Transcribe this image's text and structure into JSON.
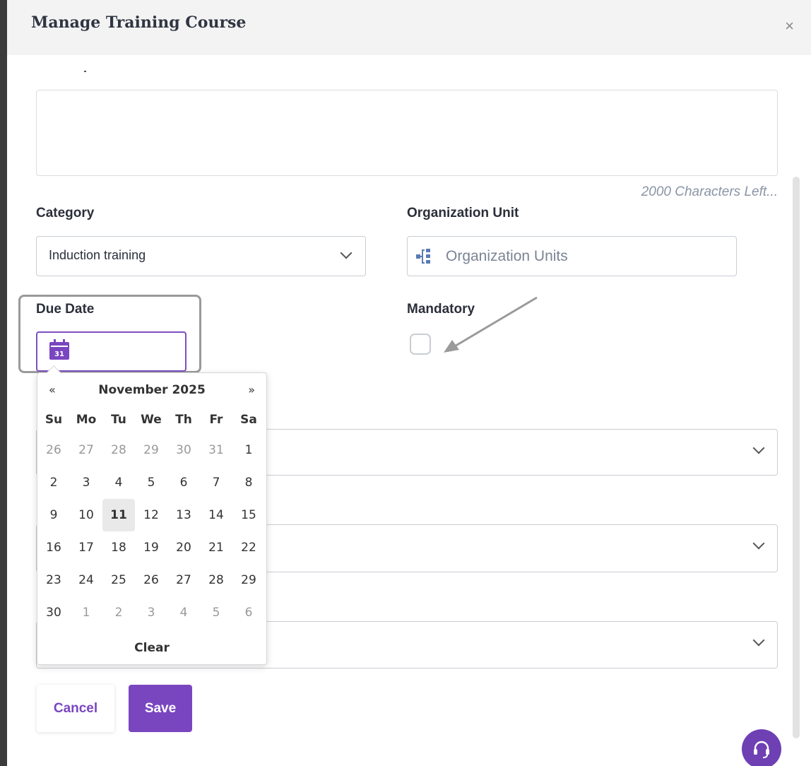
{
  "modal": {
    "title": "Manage Training Course",
    "close_symbol": "×"
  },
  "description": {
    "chars_left": "2000 Characters Left..."
  },
  "category": {
    "label": "Category",
    "value": "Induction training"
  },
  "organization_unit": {
    "label": "Organization Unit",
    "placeholder": "Organization Units"
  },
  "due_date": {
    "label": "Due Date",
    "icon_text": "31"
  },
  "mandatory": {
    "label": "Mandatory",
    "checked": false
  },
  "datepicker": {
    "prev": "«",
    "next": "»",
    "month_year": "November 2025",
    "weekdays": [
      "Su",
      "Mo",
      "Tu",
      "We",
      "Th",
      "Fr",
      "Sa"
    ],
    "weeks": [
      [
        "26",
        "27",
        "28",
        "29",
        "30",
        "31",
        "1"
      ],
      [
        "2",
        "3",
        "4",
        "5",
        "6",
        "7",
        "8"
      ],
      [
        "9",
        "10",
        "11",
        "12",
        "13",
        "14",
        "15"
      ],
      [
        "16",
        "17",
        "18",
        "19",
        "20",
        "21",
        "22"
      ],
      [
        "23",
        "24",
        "25",
        "26",
        "27",
        "28",
        "29"
      ],
      [
        "30",
        "1",
        "2",
        "3",
        "4",
        "5",
        "6"
      ]
    ],
    "today": "11",
    "clear_label": "Clear"
  },
  "actions": {
    "cancel_label": "Cancel",
    "save_label": "Save"
  },
  "colors": {
    "accent": "#7a46c0",
    "header_bg": "#f3f3f3"
  }
}
